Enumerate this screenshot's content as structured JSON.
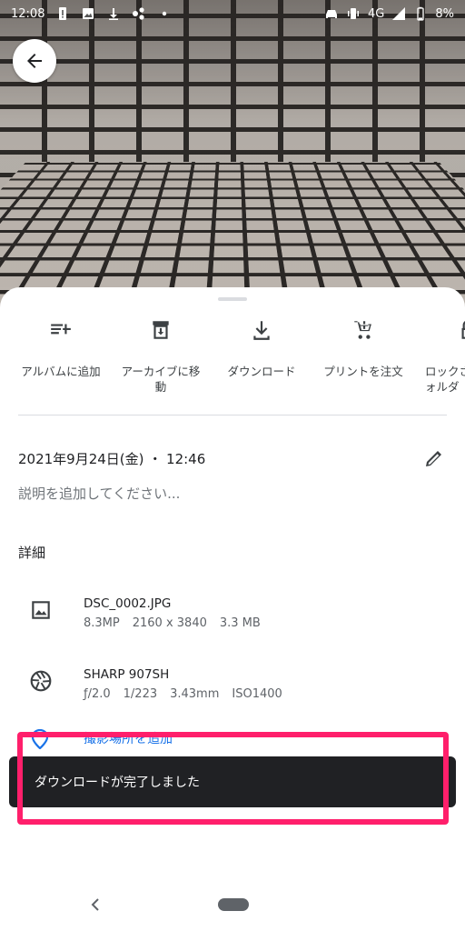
{
  "status_bar": {
    "time": "12:08",
    "network": "4G",
    "battery": "8%",
    "icons": [
      "alert-icon",
      "image-icon",
      "download-icon",
      "share-icon",
      "dot-icon",
      "car-icon",
      "vibrate-icon",
      "signal-icon",
      "battery-icon"
    ]
  },
  "header": {
    "back_icon": "arrow-back-icon"
  },
  "actions": [
    {
      "label": "アルバムに追加",
      "icon": "playlist-add-icon"
    },
    {
      "label": "アーカイブに移\n動",
      "icon": "archive-icon"
    },
    {
      "label": "ダウンロード",
      "icon": "download-icon"
    },
    {
      "label": "プリントを注文",
      "icon": "cart-icon"
    },
    {
      "label": "ロックさ\nォルダ",
      "icon": "lock-icon"
    }
  ],
  "info": {
    "datetime": "2021年9月24日(金) ・ 12:46",
    "description_placeholder": "説明を追加してください...",
    "details_heading": "詳細",
    "file": {
      "name": "DSC_0002.JPG",
      "megapixels": "8.3MP",
      "resolution": "2160 x 3840",
      "size": "3.3 MB"
    },
    "camera": {
      "model": "SHARP 907SH",
      "aperture": "ƒ/2.0",
      "shutter": "1/223",
      "focal_length": "3.43mm",
      "iso": "ISO1400"
    },
    "location_label": "撮影場所を追加"
  },
  "snackbar": {
    "message": "ダウンロードが完了しました"
  },
  "colors": {
    "accent": "#1a73e8",
    "highlight": "#ff1f6b",
    "snackbar_bg": "#202124"
  }
}
